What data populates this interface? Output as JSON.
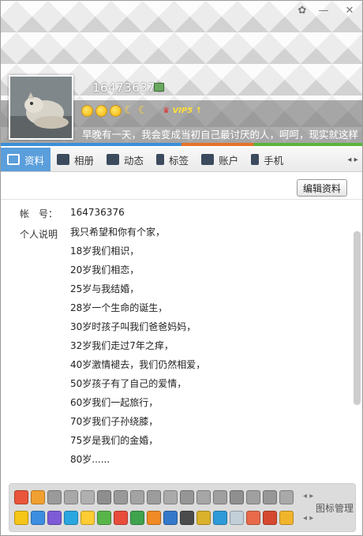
{
  "window": {
    "skin_glyph": "✿",
    "min_glyph": "—",
    "close_glyph": "✕"
  },
  "profile": {
    "nickname": "164736376",
    "vip": "VIP5",
    "sign": "早晚有一天，我会变成当初自己最讨厌的人，呵呵，现实就这样"
  },
  "tabs": [
    {
      "label": "资料",
      "icon": "profile-card-icon"
    },
    {
      "label": "相册",
      "icon": "photo-icon"
    },
    {
      "label": "动态",
      "icon": "feed-icon"
    },
    {
      "label": "标签",
      "icon": "tag-icon"
    },
    {
      "label": "账户",
      "icon": "wallet-icon"
    },
    {
      "label": "手机",
      "icon": "phone-icon"
    }
  ],
  "tabs_more": "◂ ▸",
  "toolbar": {
    "edit_label": "编辑资料"
  },
  "info": {
    "account_label": "帐　号：",
    "account_value": "164736376",
    "desc_label": "个人说明",
    "desc_lines": [
      "我只希望和你有个家，",
      "18岁我们相识，",
      "20岁我们相恋，",
      "25岁与我结婚，",
      "28岁一个生命的诞生，",
      "30岁时孩子叫我们爸爸妈妈，",
      "32岁我们走过7年之痒，",
      "40岁激情褪去，我们仍然相爱，",
      "50岁孩子有了自己的爱情，",
      "60岁我们一起旅行，",
      "70岁我们子孙绕膝，",
      "75岁是我们的金婚，",
      "80岁......"
    ]
  },
  "icon_panel": {
    "manage_label": "图标管理",
    "pager": "◂ ▸"
  },
  "colors": {
    "accent": "#5a9edb"
  }
}
